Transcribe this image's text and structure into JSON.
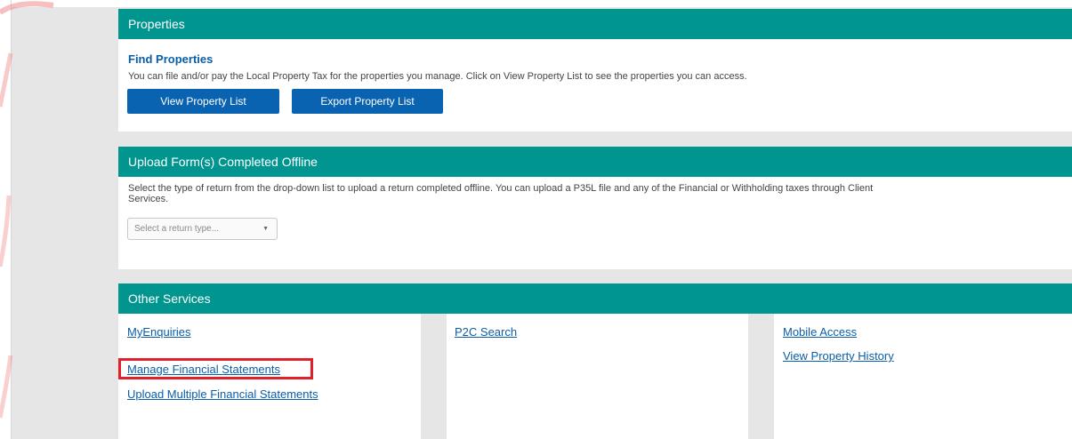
{
  "properties": {
    "header": "Properties",
    "find_title": "Find Properties",
    "description": "You can file and/or pay the Local Property Tax for the properties you manage. Click on View Property List to see the properties you can access.",
    "view_button": "View Property List",
    "export_button": "Export Property List"
  },
  "upload": {
    "header": "Upload Form(s) Completed Offline",
    "description_line1": "Select the type of return from the drop-down list to upload a return completed offline. You can upload a P35L file and any of the Financial or Withholding taxes through Client",
    "description_line2": "Services.",
    "select_placeholder": "Select a return type...",
    "select_caret": "▼"
  },
  "other": {
    "header": "Other Services",
    "col1": [
      "MyEnquiries",
      "Manage Financial Statements",
      "Upload Multiple Financial Statements"
    ],
    "col2": [
      "P2C Search"
    ],
    "col3": [
      "Mobile Access",
      "View Property History"
    ]
  },
  "colors": {
    "header_teal": "#00958f",
    "link_blue": "#0a5ea8",
    "button_blue": "#0a63b0",
    "highlight_red": "#e0202a",
    "watermark_red": "#f08a8a"
  }
}
